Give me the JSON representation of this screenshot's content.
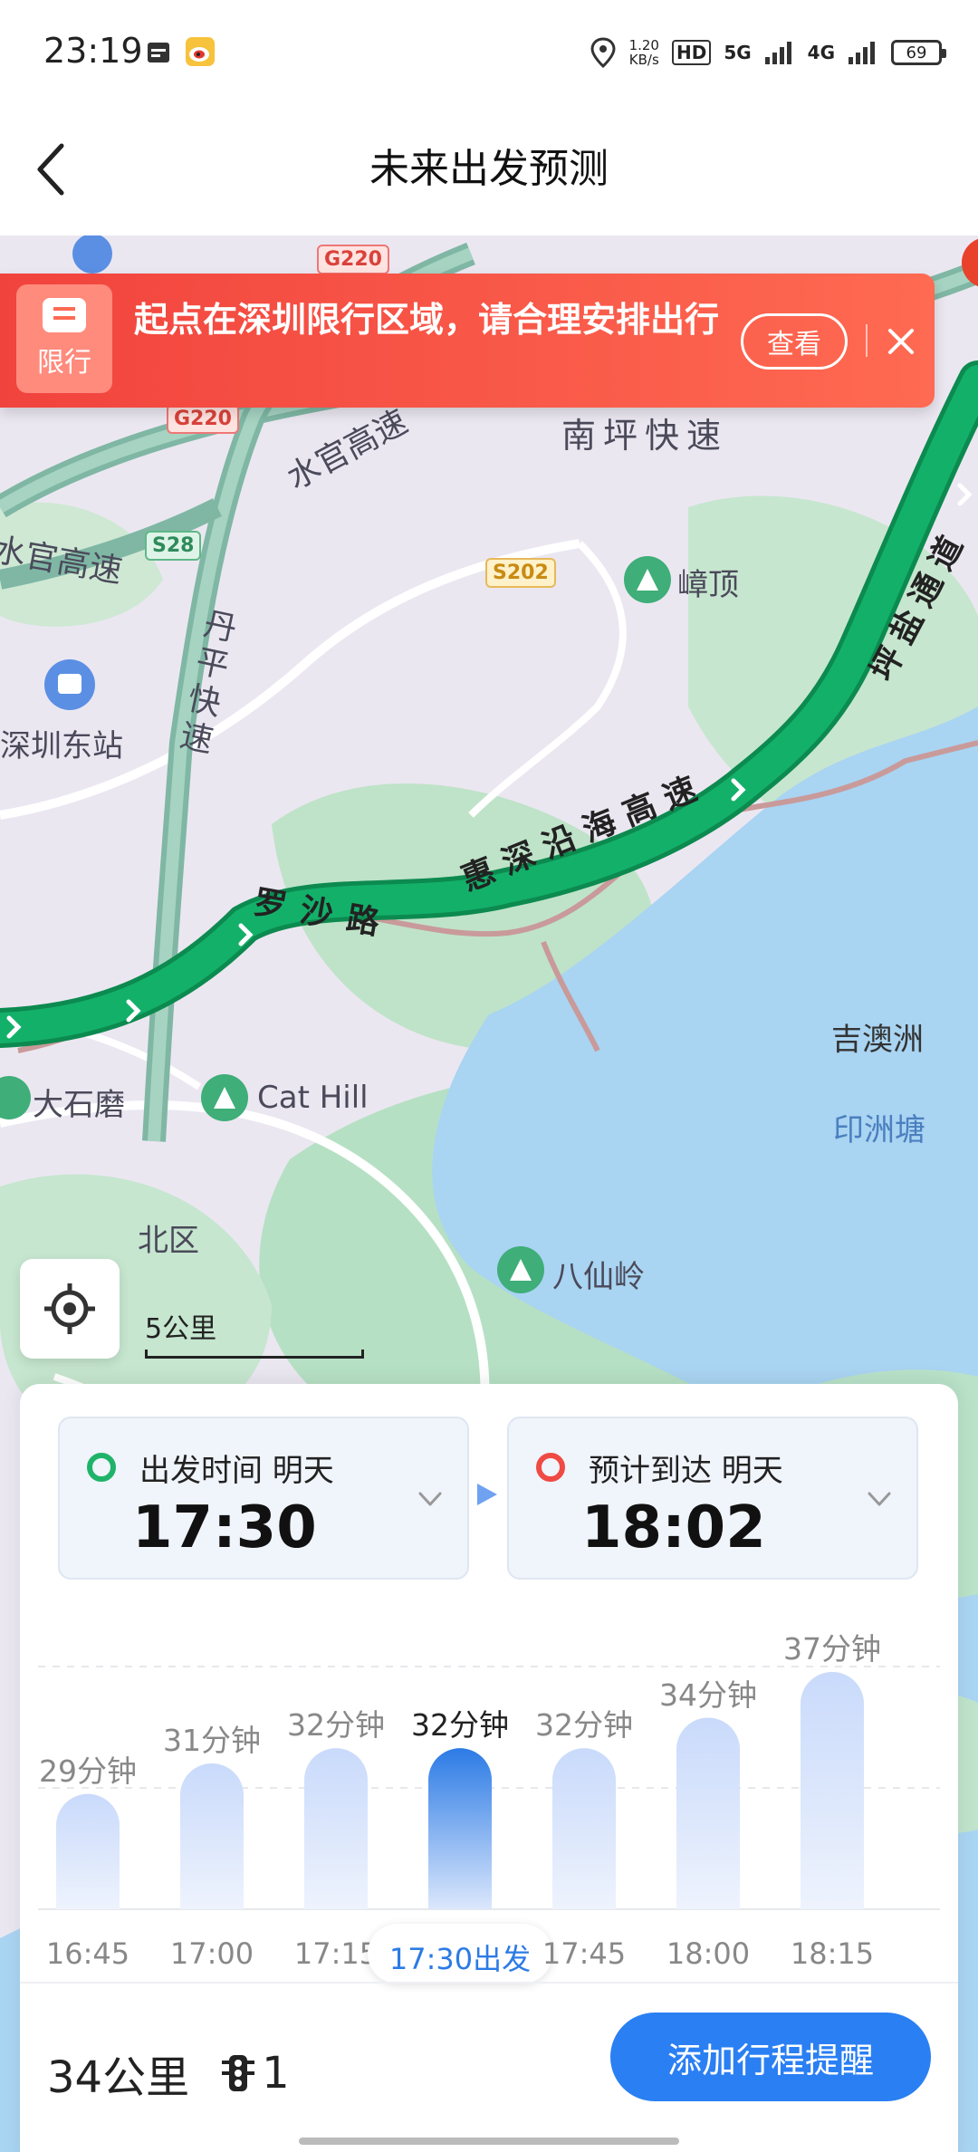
{
  "status_bar": {
    "time": "23:19",
    "speed_value": "1.20",
    "speed_unit": "KB/s",
    "hd_tag": "HD",
    "sig1": "5G",
    "sig2": "4G",
    "battery": "69"
  },
  "header": {
    "title": "未来出发预测",
    "back_icon": "chevron-left-icon"
  },
  "banner": {
    "badge_label": "限行",
    "message": "起点在深圳限行区域，请合理安排出行",
    "view_label": "查看",
    "close_icon": "close-icon",
    "colors": {
      "start": "#f1433d",
      "end": "#ff6a52"
    }
  },
  "map": {
    "labels": {
      "shuiguan1": "水官高速",
      "shuiguan2": "水官高速",
      "nanping": "南坪快速",
      "danping": "丹平快速",
      "pingyan": "坪盐通道",
      "luosha": "罗沙路",
      "huishen": "惠深沿海高速",
      "shenzhen_east": "深圳东站",
      "zhangding": "嶂顶",
      "jiaozhou": "吉澳洲",
      "yinzhoutang": "印洲塘",
      "dashimo": "大石磨",
      "cathill": "Cat Hill",
      "beiqu": "北区",
      "baxianling": "八仙岭"
    },
    "shields": {
      "g220_top": "G220",
      "g220_mid": "G220",
      "s28": "S28",
      "s202": "S202"
    },
    "scale_label": "5公里",
    "route_color": "#13b06a"
  },
  "trip": {
    "depart_label": "出发时间  明天",
    "depart_time": "17:30",
    "arrive_label": "预计到达  明天",
    "arrive_time": "18:02",
    "distance": "34公里",
    "traffic_lights": "1",
    "add_reminder_label": "添加行程提醒"
  },
  "chart_data": {
    "type": "bar",
    "categories": [
      "16:45",
      "17:00",
      "17:15",
      "17:30出发",
      "17:45",
      "18:00",
      "18:15"
    ],
    "values": [
      29,
      31,
      32,
      32,
      32,
      34,
      37
    ],
    "value_labels": [
      "29分钟",
      "31分钟",
      "32分钟",
      "32分钟",
      "32分钟",
      "34分钟",
      "37分钟"
    ],
    "selected_index": 3,
    "colors": {
      "bar": "#dbe6fb",
      "selected": "#2c7be5"
    }
  }
}
